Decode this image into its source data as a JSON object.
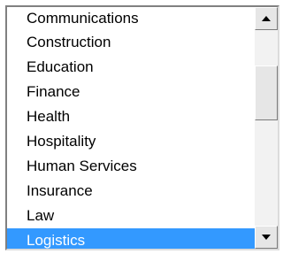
{
  "listbox": {
    "items": [
      {
        "label": "Communications"
      },
      {
        "label": "Construction"
      },
      {
        "label": "Education"
      },
      {
        "label": "Finance"
      },
      {
        "label": "Health"
      },
      {
        "label": "Hospitality"
      },
      {
        "label": "Human Services"
      },
      {
        "label": "Insurance"
      },
      {
        "label": "Law"
      },
      {
        "label": "Logistics"
      }
    ],
    "selected_index": 9,
    "selection_color": "#3399ff"
  },
  "scrollbar": {
    "up_icon": "triangle-up-icon",
    "down_icon": "triangle-down-icon"
  }
}
